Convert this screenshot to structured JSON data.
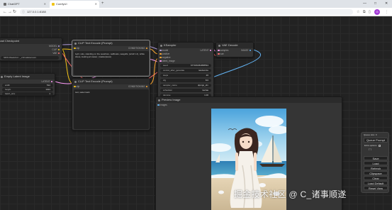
{
  "browser": {
    "tabs": [
      {
        "label": "ChatGPT",
        "active": false,
        "favicon_color": "#6b6b6b"
      },
      {
        "label": "ComfyUI",
        "active": true,
        "favicon_color": "#f0c419"
      }
    ],
    "url": "127.0.0.1:8188",
    "profile_initial": "G"
  },
  "nodes": {
    "checkpoint": {
      "title": "Load Checkpoint",
      "outputs": [
        "MODEL",
        "CLIP",
        "VAE"
      ],
      "ckpt_name_label": "ckpt_name",
      "ckpt_name_value": "SDXL\\Realvisxl..._v10.safetensors"
    },
    "empty_latent": {
      "title": "Empty Latent Image",
      "output": "LATENT",
      "widgets": [
        {
          "label": "width",
          "value": "512"
        },
        {
          "label": "height",
          "value": "1024"
        },
        {
          "label": "batch_size",
          "value": "1"
        }
      ]
    },
    "clip_pos": {
      "title": "CLIP Text Encode (Prompt)",
      "input": "clip",
      "output": "CONDITIONING",
      "text": "1girl, solo, standing on the seashore, sailboats, seagulls, (wind:1.2), white dress, looking at viewer, (masterpiece)"
    },
    "clip_neg": {
      "title": "CLIP Text Encode (Prompt)",
      "input": "clip",
      "output": "CONDITIONING",
      "text": "text, watermark"
    },
    "ksampler": {
      "title": "KSampler",
      "inputs": [
        "model",
        "positive",
        "negative",
        "latent_image"
      ],
      "output": "LATENT",
      "widgets": [
        {
          "label": "seed",
          "value": "677183454958534"
        },
        {
          "label": "control_after_generate",
          "value": "randomize"
        },
        {
          "label": "steps",
          "value": "20"
        },
        {
          "label": "cfg",
          "value": "8.0"
        },
        {
          "label": "sampler_name",
          "value": "dpmpp_2m"
        },
        {
          "label": "scheduler",
          "value": "karras"
        },
        {
          "label": "denoise",
          "value": "1.00"
        }
      ]
    },
    "vae_decode": {
      "title": "VAE Decode",
      "inputs": [
        "samples",
        "vae"
      ],
      "output": "IMAGE"
    },
    "preview": {
      "title": "Preview Image",
      "input": "images"
    }
  },
  "menu": {
    "queue_size": "Queue size: 0",
    "queue_prompt": "Queue Prompt",
    "extra_options": "Extra options",
    "buttons": [
      "Save",
      "Load",
      "Refresh",
      "Clipspace",
      "Clear",
      "Load Default",
      "Reset View"
    ]
  },
  "watermark": "掘金技术社区 @ C_诸事顺遂",
  "colors": {
    "model_link": "#b39ddb",
    "clip_link": "#f5c518",
    "vae_link": "#ff6e6e",
    "latent_link": "#ff9cf9",
    "conditioning_link": "#ffa931",
    "image_link": "#64b5f6"
  }
}
